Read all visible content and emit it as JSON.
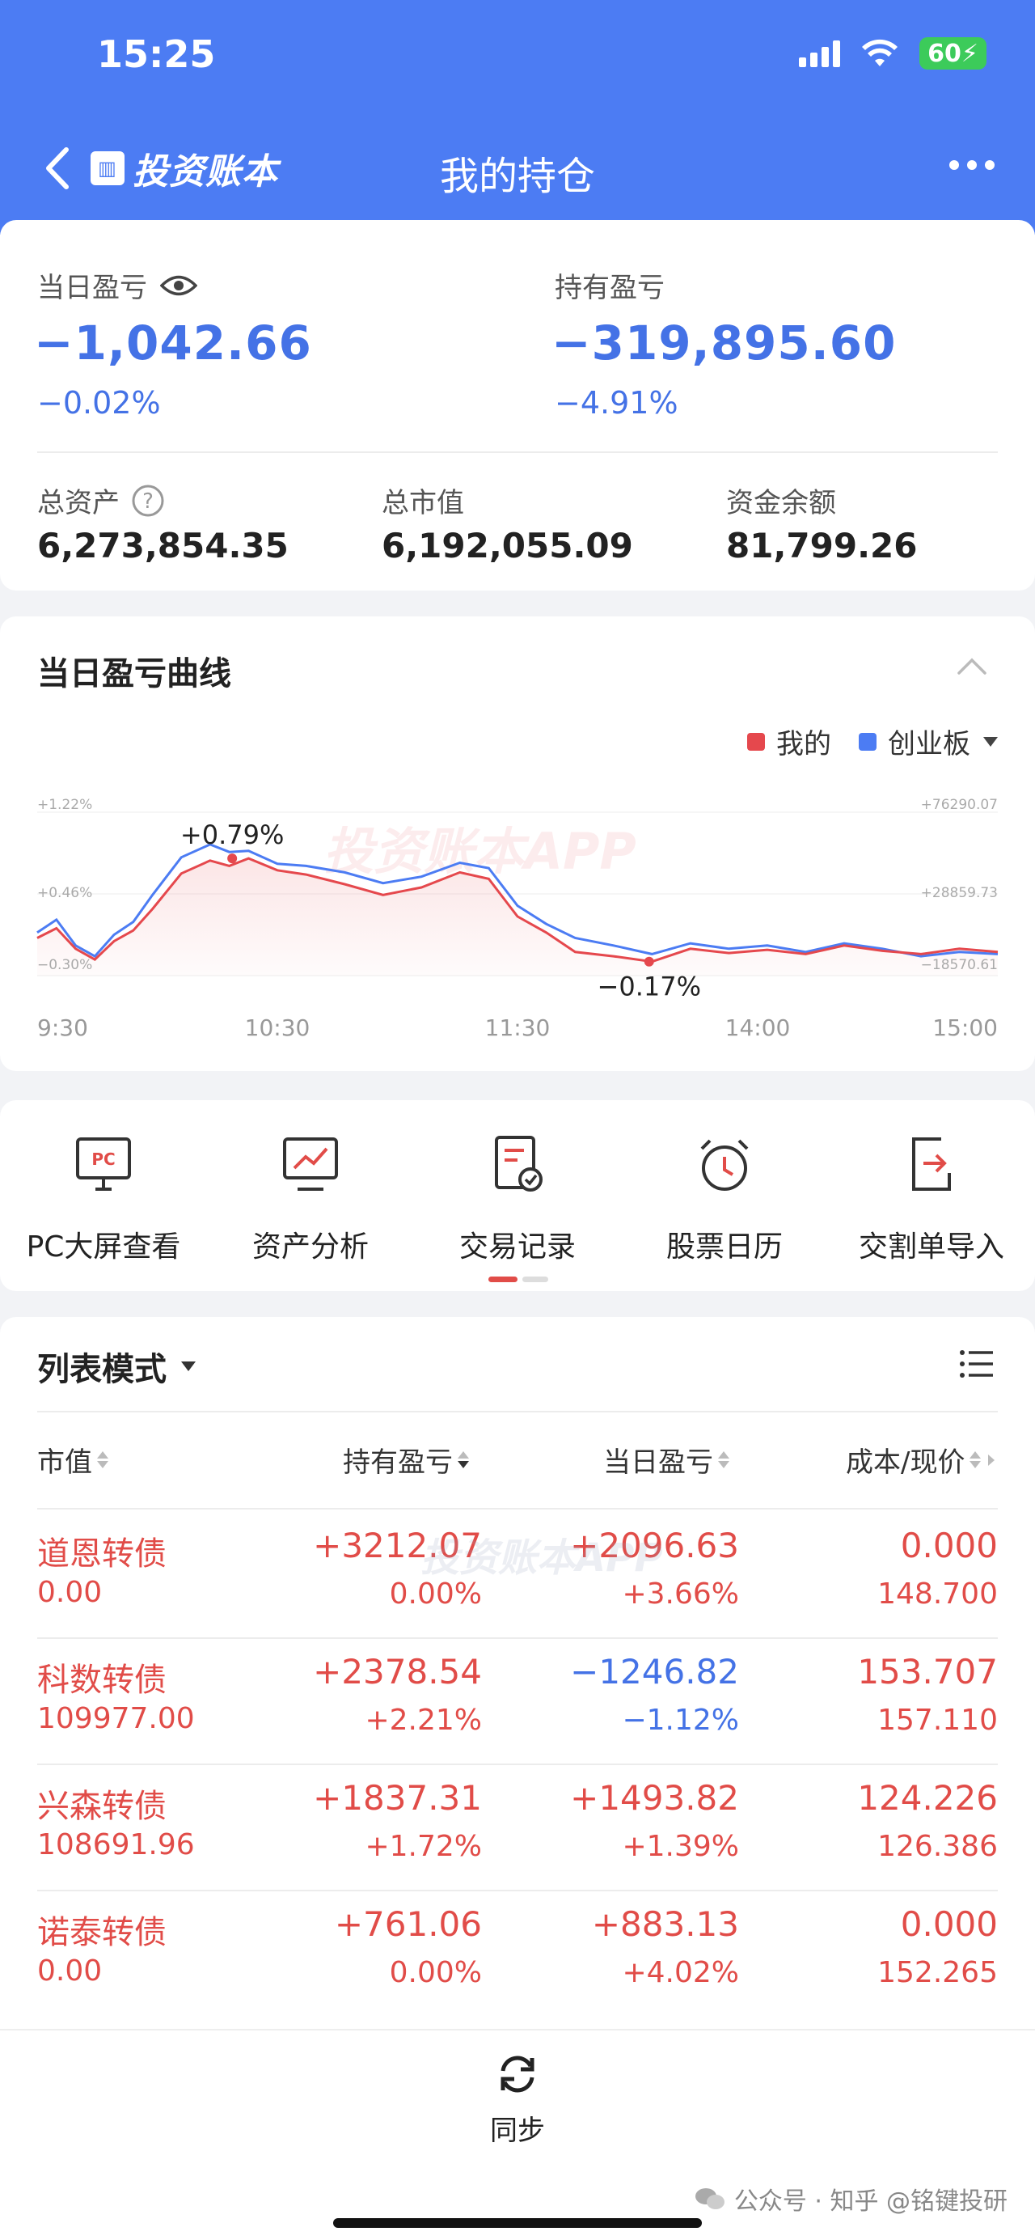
{
  "status": {
    "time": "15:25",
    "battery": "60"
  },
  "nav": {
    "brand": "投资账本",
    "title": "我的持仓"
  },
  "summary": {
    "daily_label": "当日盈亏",
    "daily_value": "−1,042.66",
    "daily_pct": "−0.02%",
    "hold_label": "持有盈亏",
    "hold_value": "−319,895.60",
    "hold_pct": "−4.91%",
    "total_assets_label": "总资产",
    "total_assets": "6,273,854.35",
    "market_value_label": "总市值",
    "market_value": "6,192,055.09",
    "cash_label": "资金余额",
    "cash": "81,799.26"
  },
  "chart": {
    "title": "当日盈亏曲线",
    "legend_mine": "我的",
    "legend_index": "创业板",
    "watermark": "投资账本APP",
    "colors": {
      "mine": "#e5484d",
      "index": "#4c7cf3"
    }
  },
  "chart_data": {
    "type": "line",
    "x_ticks": [
      "9:30",
      "10:30",
      "11:30",
      "14:00",
      "15:00"
    ],
    "left_ticks": [
      "+1.22%",
      "+0.46%",
      "−0.30%"
    ],
    "right_ticks": [
      "+76290.07",
      "+28859.73",
      "−18570.61"
    ],
    "ylim": [
      -0.3,
      1.22
    ],
    "annotations": [
      {
        "label": "+0.79%",
        "x": 0.203,
        "y": 0.79
      },
      {
        "label": "−0.17%",
        "x": 0.637,
        "y": -0.17
      }
    ],
    "series": [
      {
        "name": "我的",
        "x": [
          0,
          0.02,
          0.04,
          0.06,
          0.08,
          0.1,
          0.12,
          0.15,
          0.18,
          0.2,
          0.22,
          0.25,
          0.28,
          0.32,
          0.36,
          0.4,
          0.44,
          0.47,
          0.5,
          0.53,
          0.56,
          0.6,
          0.64,
          0.68,
          0.72,
          0.76,
          0.8,
          0.84,
          0.88,
          0.92,
          0.96,
          1.0
        ],
        "values": [
          0.05,
          0.14,
          -0.05,
          -0.15,
          0.02,
          0.12,
          0.32,
          0.65,
          0.77,
          0.72,
          0.79,
          0.68,
          0.64,
          0.55,
          0.45,
          0.52,
          0.66,
          0.6,
          0.25,
          0.1,
          -0.08,
          -0.12,
          -0.17,
          -0.05,
          -0.09,
          -0.06,
          -0.1,
          -0.02,
          -0.07,
          -0.1,
          -0.05,
          -0.08
        ]
      },
      {
        "name": "创业板",
        "x": [
          0,
          0.02,
          0.04,
          0.06,
          0.08,
          0.1,
          0.12,
          0.15,
          0.18,
          0.2,
          0.22,
          0.25,
          0.28,
          0.32,
          0.36,
          0.4,
          0.44,
          0.47,
          0.5,
          0.53,
          0.56,
          0.6,
          0.64,
          0.68,
          0.72,
          0.76,
          0.8,
          0.84,
          0.88,
          0.92,
          0.96,
          1.0
        ],
        "values": [
          0.1,
          0.22,
          -0.02,
          -0.12,
          0.08,
          0.2,
          0.45,
          0.8,
          0.92,
          0.85,
          0.86,
          0.74,
          0.72,
          0.66,
          0.56,
          0.62,
          0.75,
          0.7,
          0.35,
          0.18,
          0.05,
          -0.02,
          -0.1,
          0.0,
          -0.05,
          -0.02,
          -0.08,
          0.0,
          -0.05,
          -0.12,
          -0.08,
          -0.1
        ]
      }
    ]
  },
  "tools": [
    {
      "label": "PC大屏查看",
      "icon": "pc-monitor-icon"
    },
    {
      "label": "资产分析",
      "icon": "chart-monitor-icon"
    },
    {
      "label": "交易记录",
      "icon": "record-check-icon"
    },
    {
      "label": "股票日历",
      "icon": "alarm-clock-icon"
    },
    {
      "label": "交割单导入",
      "icon": "import-icon"
    }
  ],
  "list": {
    "mode_label": "列表模式",
    "headers": {
      "market": "市值",
      "hold": "持有盈亏",
      "daily": "当日盈亏",
      "cost": "成本/现价"
    },
    "rows": [
      {
        "name": "道恩转债",
        "market": "0.00",
        "hold": "+3212.07",
        "hold_pct": "0.00%",
        "daily": "+2096.63",
        "daily_pct": "+3.66%",
        "cost": "0.000",
        "price": "148.700",
        "daily_color": "red"
      },
      {
        "name": "科数转债",
        "market": "109977.00",
        "hold": "+2378.54",
        "hold_pct": "+2.21%",
        "daily": "−1246.82",
        "daily_pct": "−1.12%",
        "cost": "153.707",
        "price": "157.110",
        "daily_color": "blue"
      },
      {
        "name": "兴森转债",
        "market": "108691.96",
        "hold": "+1837.31",
        "hold_pct": "+1.72%",
        "daily": "+1493.82",
        "daily_pct": "+1.39%",
        "cost": "124.226",
        "price": "126.386",
        "daily_color": "red"
      },
      {
        "name": "诺泰转债",
        "market": "0.00",
        "hold": "+761.06",
        "hold_pct": "0.00%",
        "daily": "+883.13",
        "daily_pct": "+4.02%",
        "cost": "0.000",
        "price": "152.265",
        "daily_color": "red"
      }
    ]
  },
  "bottom": {
    "sync_label": "同步",
    "footer_text": "公众号 · 知乎 @铭键投研"
  }
}
